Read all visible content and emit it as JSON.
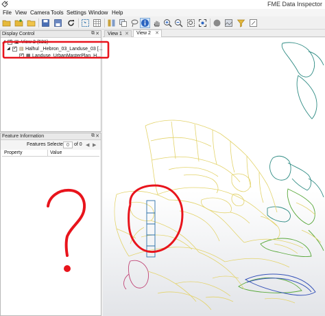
{
  "window": {
    "title": "FME Data Inspector"
  },
  "menu": {
    "items": [
      "File",
      "View",
      "Camera",
      "Tools",
      "Settings",
      "Window",
      "Help"
    ]
  },
  "toolbar": {
    "buttons": [
      "folder-open-icon",
      "folder-add-icon",
      "folder-icon",
      "save-icon",
      "save-as-icon",
      "refresh-icon",
      "select-icon",
      "table-icon",
      "split-view-icon",
      "duplicate-icon",
      "lasso-icon",
      "info-icon",
      "pan-hand-icon",
      "zoom-in-icon",
      "zoom-out-icon",
      "zoom-box-icon",
      "zoom-extent-icon",
      "record-icon",
      "background-icon",
      "filter-icon",
      "help-icon"
    ]
  },
  "display_control": {
    "title": "Display Control",
    "tree": {
      "view": "View 2 (521)",
      "dataset": "Halhul _Hebron_03_Landuse_03 [...",
      "layer": "Landuse_UrbanMasterPlan_H..."
    }
  },
  "feature_info": {
    "title": "Feature Information",
    "selected_label": "Features Selected:",
    "selected_value": "0",
    "of_label": "of 0",
    "columns": [
      "Property",
      "Value"
    ]
  },
  "view_tabs": [
    {
      "label": "View 1"
    },
    {
      "label": "View 2"
    }
  ],
  "annotation": {
    "mark": "?",
    "color": "#e8141c"
  },
  "colors": {
    "parcel_yellow": "#e3d36a",
    "parcel_teal": "#2e8b83",
    "parcel_green": "#58a83a",
    "parcel_blue": "#3552b8",
    "parcel_pink": "#c04576",
    "selection": "#2a6fa8"
  }
}
